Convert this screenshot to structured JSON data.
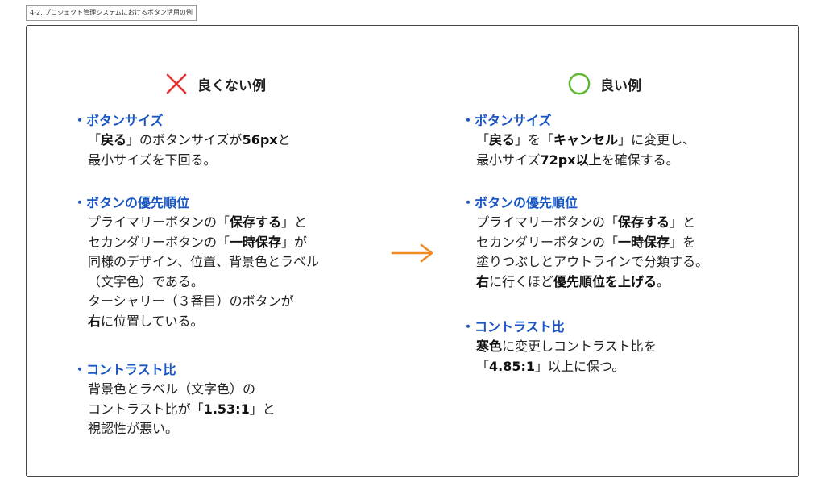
{
  "caption": "4-2. プロジェクト管理システムにおけるボタン活用の例",
  "bad": {
    "heading": "良くない例",
    "sections": [
      {
        "title": "ボタンサイズ",
        "lines": [
          [
            {
              "t": "「"
            },
            {
              "t": "戻る",
              "b": true
            },
            {
              "t": "」のボタンサイズが"
            },
            {
              "t": "56px",
              "b": true
            },
            {
              "t": "と"
            }
          ],
          [
            {
              "t": "最小サイズを下回る。"
            }
          ]
        ]
      },
      {
        "title": "ボタンの優先順位",
        "lines": [
          [
            {
              "t": "プライマリーボタンの「"
            },
            {
              "t": "保存する",
              "b": true
            },
            {
              "t": "」と"
            }
          ],
          [
            {
              "t": "セカンダリーボタンの「"
            },
            {
              "t": "一時保存",
              "b": true
            },
            {
              "t": "」が"
            }
          ],
          [
            {
              "t": "同様のデザイン、位置、背景色とラベル"
            }
          ],
          [
            {
              "t": "（文字色）である。"
            }
          ],
          [
            {
              "t": "ターシャリー（３番目）のボタンが"
            }
          ],
          [
            {
              "t": "右",
              "b": true
            },
            {
              "t": "に位置している。"
            }
          ]
        ]
      },
      {
        "title": "コントラスト比",
        "lines": [
          [
            {
              "t": "背景色とラベル（文字色）の"
            }
          ],
          [
            {
              "t": "コントラスト比が「"
            },
            {
              "t": "1.53:1",
              "b": true
            },
            {
              "t": "」と"
            }
          ],
          [
            {
              "t": "視認性が悪い。"
            }
          ]
        ]
      }
    ]
  },
  "good": {
    "heading": "良い例",
    "sections": [
      {
        "title": "ボタンサイズ",
        "lines": [
          [
            {
              "t": "「"
            },
            {
              "t": "戻る",
              "b": true
            },
            {
              "t": "」を「"
            },
            {
              "t": "キャンセル",
              "b": true
            },
            {
              "t": "」に変更し、"
            }
          ],
          [
            {
              "t": "最小サイズ"
            },
            {
              "t": "72px以上",
              "b": true
            },
            {
              "t": "を確保する。"
            }
          ]
        ]
      },
      {
        "title": "ボタンの優先順位",
        "lines": [
          [
            {
              "t": "プライマリーボタンの「"
            },
            {
              "t": "保存する",
              "b": true
            },
            {
              "t": "」と"
            }
          ],
          [
            {
              "t": "セカンダリーボタンの「"
            },
            {
              "t": "一時保存",
              "b": true
            },
            {
              "t": "」を"
            }
          ],
          [
            {
              "t": "塗りつぶしとアウトラインで分類する。"
            }
          ],
          [
            {
              "t": "右",
              "b": true
            },
            {
              "t": "に行くほど"
            },
            {
              "t": "優先順位を上げる",
              "b": true
            },
            {
              "t": "。"
            }
          ]
        ]
      },
      {
        "title": "コントラスト比",
        "lines": [
          [
            {
              "t": "寒色",
              "b": true
            },
            {
              "t": "に変更しコントラスト比を"
            }
          ],
          [
            {
              "t": "「"
            },
            {
              "t": "4.85:1",
              "b": true
            },
            {
              "t": "」以上に保つ。"
            }
          ]
        ]
      }
    ]
  },
  "colors": {
    "bad_mark": "#e83030",
    "good_mark": "#5cb82e",
    "arrow": "#f08a24",
    "section_title": "#1a56c4"
  }
}
